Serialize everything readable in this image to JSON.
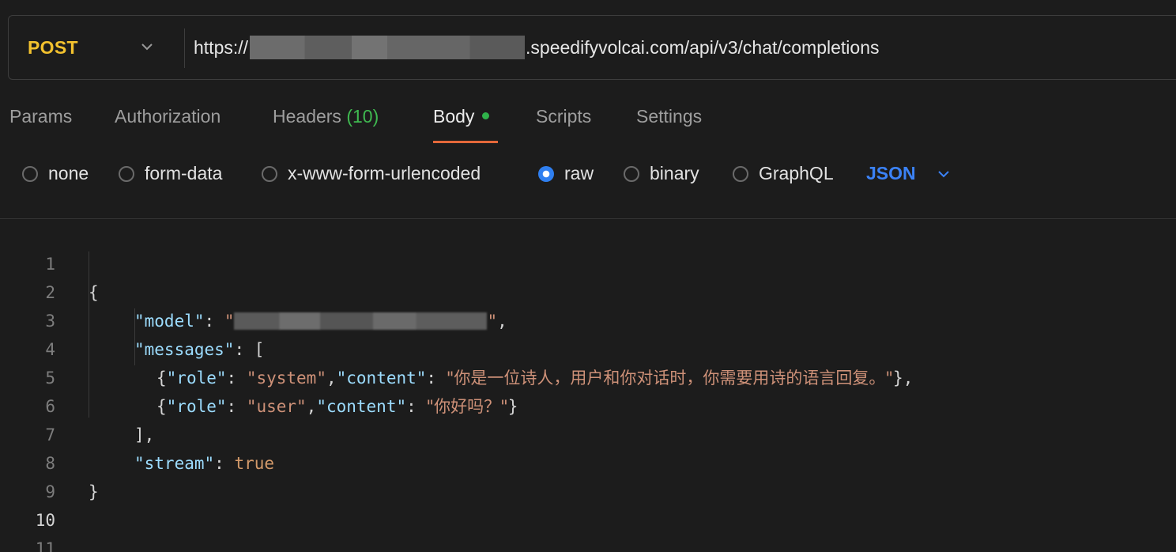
{
  "request": {
    "method": "POST",
    "url_prefix": "https://",
    "url_suffix": ".speedifyvolcai.com/api/v3/chat/completions"
  },
  "tabs": [
    {
      "label": "Params"
    },
    {
      "label": "Authorization"
    },
    {
      "label": "Headers",
      "count": "(10)"
    },
    {
      "label": "Body",
      "active": true
    },
    {
      "label": "Scripts"
    },
    {
      "label": "Settings"
    }
  ],
  "body_types": [
    {
      "label": "none",
      "checked": false
    },
    {
      "label": "form-data",
      "checked": false
    },
    {
      "label": "x-www-form-urlencoded",
      "checked": false
    },
    {
      "label": "raw",
      "checked": true
    },
    {
      "label": "binary",
      "checked": false
    },
    {
      "label": "GraphQL",
      "checked": false
    }
  ],
  "format": "JSON",
  "editor": {
    "line_numbers": [
      "1",
      "2",
      "3",
      "4",
      "5",
      "6",
      "7",
      "8",
      "9",
      "10",
      "11"
    ],
    "code": {
      "open_brace": "{",
      "model_key": "\"model\"",
      "messages_key": "\"messages\"",
      "role_key": "\"role\"",
      "content_key": "\"content\"",
      "system_role": "\"system\"",
      "system_content": "\"你是一位诗人，用户和你对话时，你需要用诗的语言回复。\"",
      "user_role": "\"user\"",
      "user_content": "\"你好吗？\"",
      "stream_key": "\"stream\"",
      "stream_value": "true",
      "close_brace": "}"
    }
  },
  "colors": {
    "method": "#f2c12e",
    "accent_underline": "#e4683a",
    "body_dot": "#2fb24a",
    "radio_checked": "#2f7ff0",
    "format": "#3b82f6"
  }
}
